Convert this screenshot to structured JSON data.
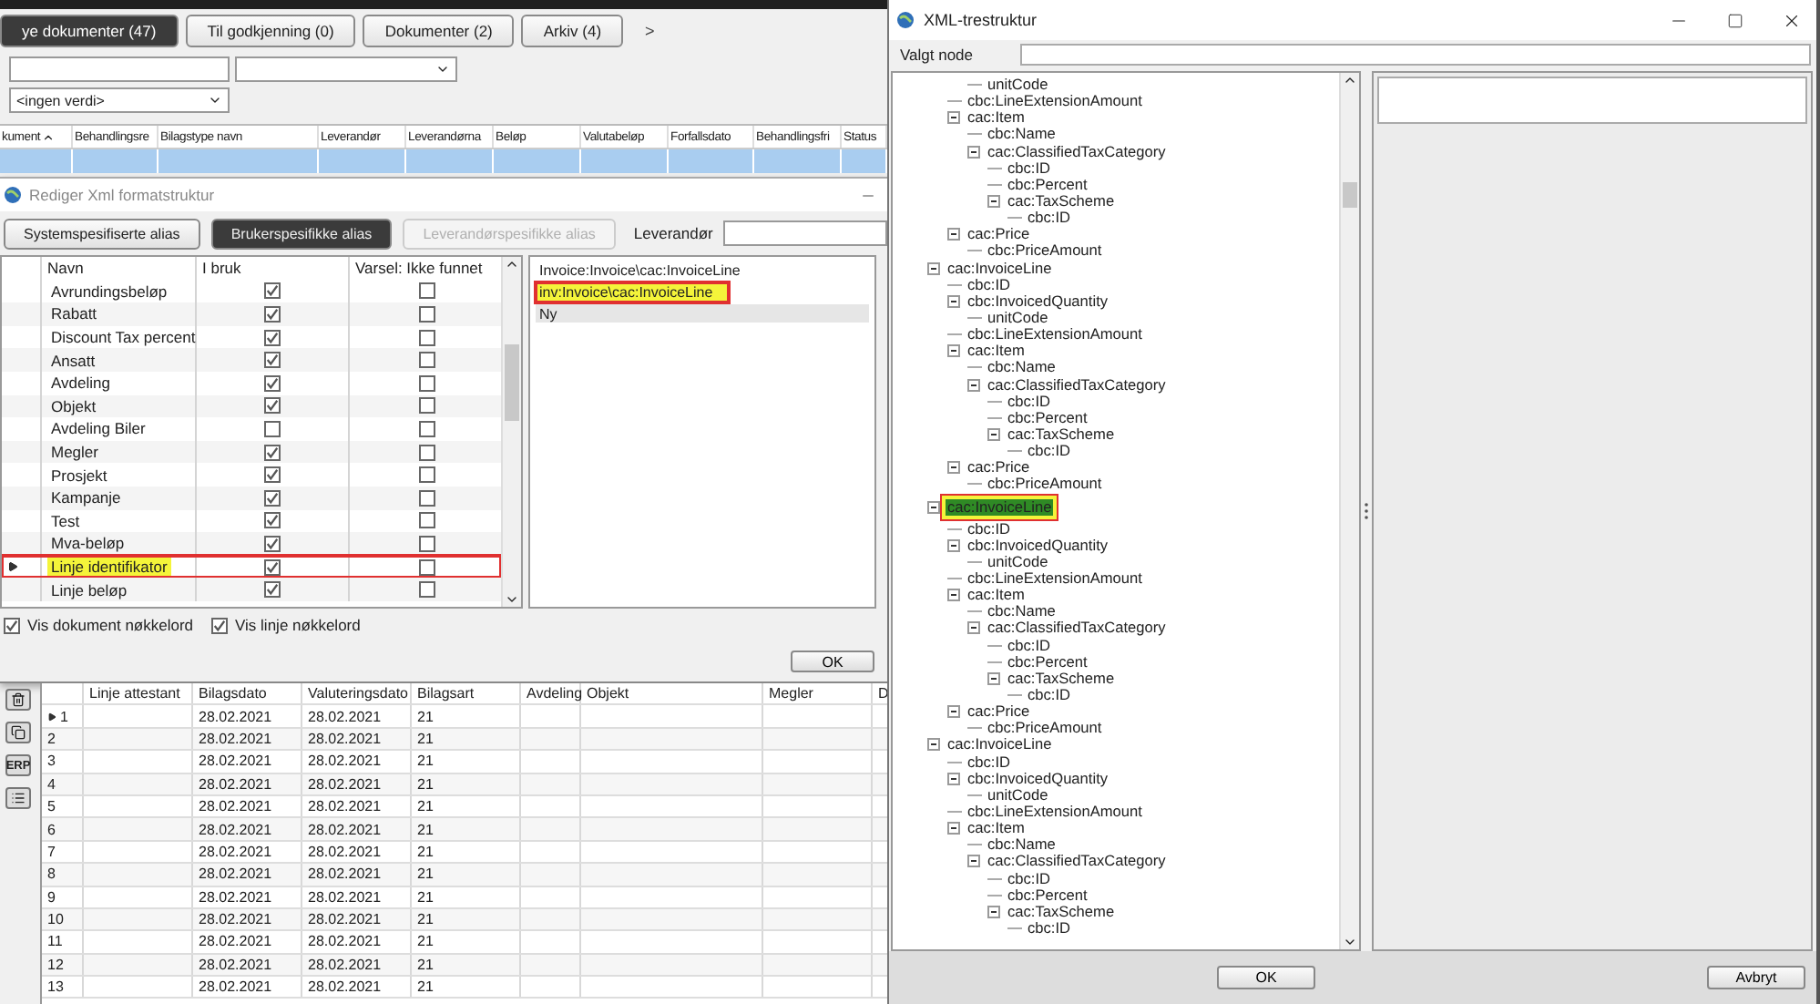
{
  "main_window": {
    "tabs": [
      {
        "label": "ye dokumenter (47)",
        "selected": true
      },
      {
        "label": "Til godkjenning (0)",
        "selected": false
      },
      {
        "label": "Dokumenter (2)",
        "selected": false
      },
      {
        "label": "Arkiv (4)",
        "selected": false
      }
    ],
    "tab_more": ">",
    "value_dropdown": "<ingen verdi>",
    "document_columns": [
      {
        "label": "kument",
        "sorted": true
      },
      {
        "label": "Behandlingsre",
        "sorted": false
      },
      {
        "label": "Bilagstype navn",
        "sorted": false
      },
      {
        "label": "Leverandør",
        "sorted": false
      },
      {
        "label": "Leverandørna",
        "sorted": false
      },
      {
        "label": "Beløp",
        "sorted": false
      },
      {
        "label": "Valutabeløp",
        "sorted": false
      },
      {
        "label": "Forfallsdato",
        "sorted": false
      },
      {
        "label": "Behandlingsfri",
        "sorted": false
      },
      {
        "label": "Status",
        "sorted": false
      }
    ],
    "document_rows": [
      {
        "selected": true
      }
    ]
  },
  "format_dialog": {
    "title": "Rediger Xml formatstruktur",
    "alias_tabs": [
      {
        "label": "Systemspesifiserte alias",
        "selected": false,
        "disabled": false
      },
      {
        "label": "Brukerspesifikke alias",
        "selected": true,
        "disabled": false
      },
      {
        "label": "Leverandørspesifikke alias",
        "selected": false,
        "disabled": true
      }
    ],
    "supplier_label": "Leverandør",
    "columns": [
      "Navn",
      "I bruk",
      "Varsel: Ikke funnet"
    ],
    "rows": [
      {
        "name": "Avrundingsbeløp",
        "in_use": true,
        "warn_not_found": false,
        "selected": false
      },
      {
        "name": "Rabatt",
        "in_use": true,
        "warn_not_found": false,
        "selected": false
      },
      {
        "name": "Discount Tax percent",
        "in_use": true,
        "warn_not_found": false,
        "selected": false
      },
      {
        "name": "Ansatt",
        "in_use": true,
        "warn_not_found": false,
        "selected": false
      },
      {
        "name": "Avdeling",
        "in_use": true,
        "warn_not_found": false,
        "selected": false
      },
      {
        "name": "Objekt",
        "in_use": true,
        "warn_not_found": false,
        "selected": false
      },
      {
        "name": "Avdeling Biler",
        "in_use": false,
        "warn_not_found": false,
        "selected": false
      },
      {
        "name": "Megler",
        "in_use": true,
        "warn_not_found": false,
        "selected": false
      },
      {
        "name": "Prosjekt",
        "in_use": true,
        "warn_not_found": false,
        "selected": false
      },
      {
        "name": "Kampanje",
        "in_use": true,
        "warn_not_found": false,
        "selected": false
      },
      {
        "name": "Test",
        "in_use": true,
        "warn_not_found": false,
        "selected": false
      },
      {
        "name": "Mva-beløp",
        "in_use": true,
        "warn_not_found": false,
        "selected": false
      },
      {
        "name": "Linje identifikator",
        "in_use": true,
        "warn_not_found": false,
        "selected": true,
        "annotated": true
      },
      {
        "name": "Linje beløp",
        "in_use": true,
        "warn_not_found": false,
        "selected": false
      }
    ],
    "paths": [
      {
        "text": "Invoice:Invoice\\cac:InvoiceLine",
        "selected": false
      },
      {
        "text": "inv:Invoice\\cac:InvoiceLine",
        "selected": false,
        "annotated": true
      },
      {
        "text": "Ny",
        "selected": true
      }
    ],
    "options": [
      {
        "label": "Vis dokument nøkkelord",
        "checked": true
      },
      {
        "label": "Vis linje nøkkelord",
        "checked": true
      }
    ],
    "ok": "OK"
  },
  "line_table": {
    "toolbar_text": "ERP",
    "columns": [
      "Linje attestant",
      "Bilagsdato",
      "Valuteringsdato",
      "Bilagsart",
      "Avdeling",
      "Objekt",
      "Megler",
      "D"
    ],
    "rows": [
      {
        "number": "1",
        "selected": true,
        "bilagsdato": "28.02.2021",
        "valuteringsdato": "28.02.2021",
        "bilagsart": "21"
      },
      {
        "number": "2",
        "selected": false,
        "bilagsdato": "28.02.2021",
        "valuteringsdato": "28.02.2021",
        "bilagsart": "21"
      },
      {
        "number": "3",
        "selected": false,
        "bilagsdato": "28.02.2021",
        "valuteringsdato": "28.02.2021",
        "bilagsart": "21"
      },
      {
        "number": "4",
        "selected": false,
        "bilagsdato": "28.02.2021",
        "valuteringsdato": "28.02.2021",
        "bilagsart": "21"
      },
      {
        "number": "5",
        "selected": false,
        "bilagsdato": "28.02.2021",
        "valuteringsdato": "28.02.2021",
        "bilagsart": "21"
      },
      {
        "number": "6",
        "selected": false,
        "bilagsdato": "28.02.2021",
        "valuteringsdato": "28.02.2021",
        "bilagsart": "21"
      },
      {
        "number": "7",
        "selected": false,
        "bilagsdato": "28.02.2021",
        "valuteringsdato": "28.02.2021",
        "bilagsart": "21"
      },
      {
        "number": "8",
        "selected": false,
        "bilagsdato": "28.02.2021",
        "valuteringsdato": "28.02.2021",
        "bilagsart": "21"
      },
      {
        "number": "9",
        "selected": false,
        "bilagsdato": "28.02.2021",
        "valuteringsdato": "28.02.2021",
        "bilagsart": "21"
      },
      {
        "number": "10",
        "selected": false,
        "bilagsdato": "28.02.2021",
        "valuteringsdato": "28.02.2021",
        "bilagsart": "21"
      },
      {
        "number": "11",
        "selected": false,
        "bilagsdato": "28.02.2021",
        "valuteringsdato": "28.02.2021",
        "bilagsart": "21"
      },
      {
        "number": "12",
        "selected": false,
        "bilagsdato": "28.02.2021",
        "valuteringsdato": "28.02.2021",
        "bilagsart": "21"
      },
      {
        "number": "13",
        "selected": false,
        "bilagsdato": "28.02.2021",
        "valuteringsdato": "28.02.2021",
        "bilagsart": "21"
      }
    ]
  },
  "xml_window": {
    "title": "XML-trestruktur",
    "selected_node_label": "Valgt node",
    "nodes": [
      {
        "children": [
          {
            "children": [
              {
                "label": "unitCode",
                "selected": false
              }
            ]
          },
          {
            "label": "cbc:LineExtensionAmount",
            "selected": false
          },
          {
            "label": "cac:Item",
            "expanded": true,
            "selected": false,
            "children": [
              {
                "label": "cbc:Name",
                "selected": false
              },
              {
                "label": "cac:ClassifiedTaxCategory",
                "expanded": true,
                "selected": false,
                "children": [
                  {
                    "label": "cbc:ID",
                    "selected": false
                  },
                  {
                    "label": "cbc:Percent",
                    "selected": false
                  },
                  {
                    "label": "cac:TaxScheme",
                    "expanded": true,
                    "selected": false,
                    "children": [
                      {
                        "label": "cbc:ID",
                        "selected": false
                      }
                    ]
                  }
                ]
              }
            ]
          },
          {
            "label": "cac:Price",
            "expanded": true,
            "selected": false,
            "children": [
              {
                "label": "cbc:PriceAmount",
                "selected": false
              }
            ]
          }
        ]
      },
      {
        "label": "cac:InvoiceLine",
        "expanded": true,
        "selected": false,
        "children": [
          {
            "label": "cbc:ID",
            "selected": false
          },
          {
            "label": "cbc:InvoicedQuantity",
            "expanded": true,
            "selected": false,
            "children": [
              {
                "label": "unitCode",
                "selected": false
              }
            ]
          },
          {
            "label": "cbc:LineExtensionAmount",
            "selected": false
          },
          {
            "label": "cac:Item",
            "expanded": true,
            "selected": false,
            "children": [
              {
                "label": "cbc:Name",
                "selected": false
              },
              {
                "label": "cac:ClassifiedTaxCategory",
                "expanded": true,
                "selected": false,
                "children": [
                  {
                    "label": "cbc:ID",
                    "selected": false
                  },
                  {
                    "label": "cbc:Percent",
                    "selected": false
                  },
                  {
                    "label": "cac:TaxScheme",
                    "expanded": true,
                    "selected": false,
                    "children": [
                      {
                        "label": "cbc:ID",
                        "selected": false
                      }
                    ]
                  }
                ]
              }
            ]
          },
          {
            "label": "cac:Price",
            "expanded": true,
            "selected": false,
            "children": [
              {
                "label": "cbc:PriceAmount",
                "selected": false
              }
            ]
          }
        ]
      },
      {
        "label": "cac:InvoiceLine",
        "expanded": true,
        "selected": true,
        "annotated": true,
        "children": [
          {
            "label": "cbc:ID",
            "selected": false
          },
          {
            "label": "cbc:InvoicedQuantity",
            "expanded": true,
            "selected": false,
            "children": [
              {
                "label": "unitCode",
                "selected": false
              }
            ]
          },
          {
            "label": "cbc:LineExtensionAmount",
            "selected": false
          },
          {
            "label": "cac:Item",
            "expanded": true,
            "selected": false,
            "children": [
              {
                "label": "cbc:Name",
                "selected": false
              },
              {
                "label": "cac:ClassifiedTaxCategory",
                "expanded": true,
                "selected": false,
                "children": [
                  {
                    "label": "cbc:ID",
                    "selected": false
                  },
                  {
                    "label": "cbc:Percent",
                    "selected": false
                  },
                  {
                    "label": "cac:TaxScheme",
                    "expanded": true,
                    "selected": false,
                    "children": [
                      {
                        "label": "cbc:ID",
                        "selected": false
                      }
                    ]
                  }
                ]
              }
            ]
          },
          {
            "label": "cac:Price",
            "expanded": true,
            "selected": false,
            "children": [
              {
                "label": "cbc:PriceAmount",
                "selected": false
              }
            ]
          }
        ]
      },
      {
        "label": "cac:InvoiceLine",
        "expanded": true,
        "selected": false,
        "children": [
          {
            "label": "cbc:ID",
            "selected": false
          },
          {
            "label": "cbc:InvoicedQuantity",
            "expanded": true,
            "selected": false,
            "children": [
              {
                "label": "unitCode",
                "selected": false
              }
            ]
          },
          {
            "label": "cbc:LineExtensionAmount",
            "selected": false
          },
          {
            "label": "cac:Item",
            "expanded": true,
            "selected": false,
            "children": [
              {
                "label": "cbc:Name",
                "selected": false
              },
              {
                "label": "cac:ClassifiedTaxCategory",
                "expanded": true,
                "selected": false,
                "children": [
                  {
                    "label": "cbc:ID",
                    "selected": false
                  },
                  {
                    "label": "cbc:Percent",
                    "selected": false
                  },
                  {
                    "label": "cac:TaxScheme",
                    "expanded": true,
                    "selected": false,
                    "children": [
                      {
                        "label": "cbc:ID",
                        "selected": false
                      }
                    ]
                  }
                ]
              }
            ]
          }
        ]
      }
    ],
    "ok": "OK",
    "cancel": "Avbryt"
  }
}
